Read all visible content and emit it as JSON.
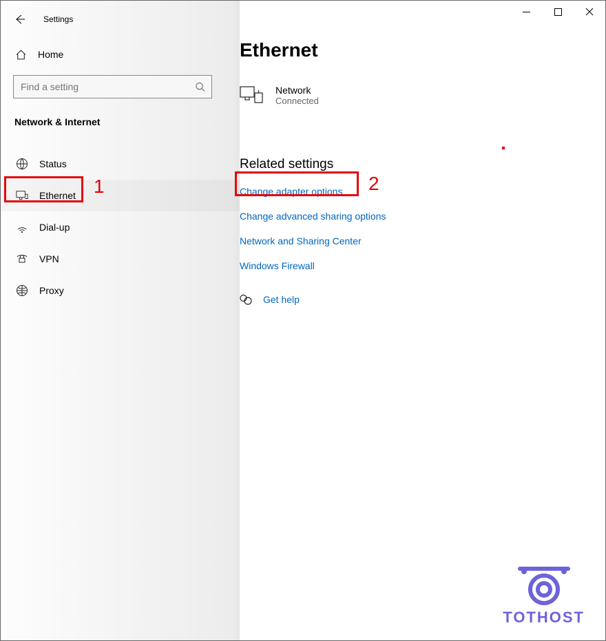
{
  "window": {
    "title": "Settings"
  },
  "sidebar": {
    "home": "Home",
    "search_placeholder": "Find a setting",
    "category": "Network & Internet",
    "items": [
      {
        "label": "Status",
        "icon": "status"
      },
      {
        "label": "Ethernet",
        "icon": "ethernet",
        "selected": true
      },
      {
        "label": "Dial-up",
        "icon": "dialup"
      },
      {
        "label": "VPN",
        "icon": "vpn"
      },
      {
        "label": "Proxy",
        "icon": "proxy"
      }
    ]
  },
  "main": {
    "title": "Ethernet",
    "network": {
      "name": "Network",
      "status": "Connected"
    },
    "related_heading": "Related settings",
    "links": [
      "Change adapter options",
      "Change advanced sharing options",
      "Network and Sharing Center",
      "Windows Firewall"
    ],
    "help": "Get help"
  },
  "annotations": {
    "box1_label": "1",
    "box2_label": "2"
  },
  "watermark": {
    "text": "TOTHOST"
  }
}
